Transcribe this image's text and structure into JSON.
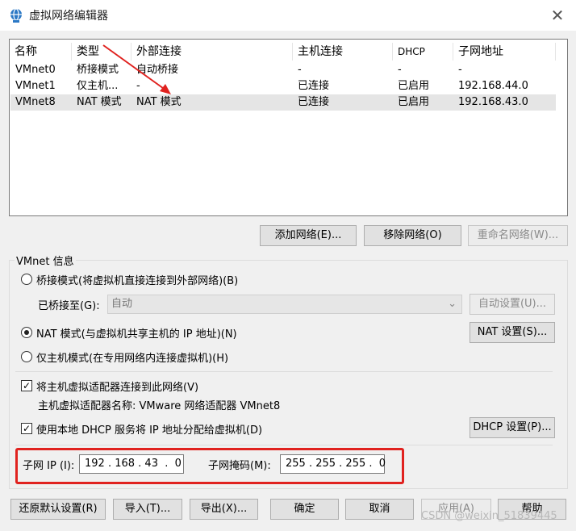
{
  "window": {
    "title": "虚拟网络编辑器",
    "close_glyph": "✕"
  },
  "table": {
    "headers": [
      "名称",
      "类型",
      "外部连接",
      "主机连接",
      "DHCP",
      "子网地址"
    ],
    "rows": [
      [
        "VMnet0",
        "桥接模式",
        "自动桥接",
        "-",
        "-",
        "-"
      ],
      [
        "VMnet1",
        "仅主机...",
        "-",
        "已连接",
        "已启用",
        "192.168.44.0"
      ],
      [
        "VMnet8",
        "NAT 模式",
        "NAT 模式",
        "已连接",
        "已启用",
        "192.168.43.0"
      ]
    ],
    "selected_row": 2
  },
  "table_buttons": {
    "add": "添加网络(E)...",
    "remove": "移除网络(O)",
    "rename": "重命名网络(W)..."
  },
  "vmnet_info": {
    "group_label": "VMnet 信息",
    "bridged": "桥接模式(将虚拟机直接连接到外部网络)(B)",
    "bridged_to_label": "已桥接至(G):",
    "bridged_to_value": "自动",
    "auto_settings": "自动设置(U)...",
    "nat": "NAT 模式(与虚拟机共享主机的 IP 地址)(N)",
    "nat_settings": "NAT 设置(S)...",
    "host_only": "仅主机模式(在专用网络内连接虚拟机)(H)",
    "connect_adapter": "将主机虚拟适配器连接到此网络(V)",
    "adapter_name": "主机虚拟适配器名称: VMware 网络适配器 VMnet8",
    "use_dhcp": "使用本地 DHCP 服务将 IP 地址分配给虚拟机(D)",
    "dhcp_settings": "DHCP 设置(P)...",
    "subnet_ip_label": "子网 IP (I):",
    "subnet_ip": "192 . 168 . 43  .  0",
    "subnet_mask_label": "子网掩码(M):",
    "subnet_mask": "255 . 255 . 255 .  0"
  },
  "bottom_buttons": {
    "restore": "还原默认设置(R)",
    "import": "导入(T)...",
    "export": "导出(X)...",
    "ok": "确定",
    "cancel": "取消",
    "apply": "应用(A)",
    "help": "帮助"
  },
  "watermark": "CSDN @weixin_51839445",
  "colors": {
    "highlight_box": "#e0221f",
    "annotation_arrow": "#e0221f"
  }
}
